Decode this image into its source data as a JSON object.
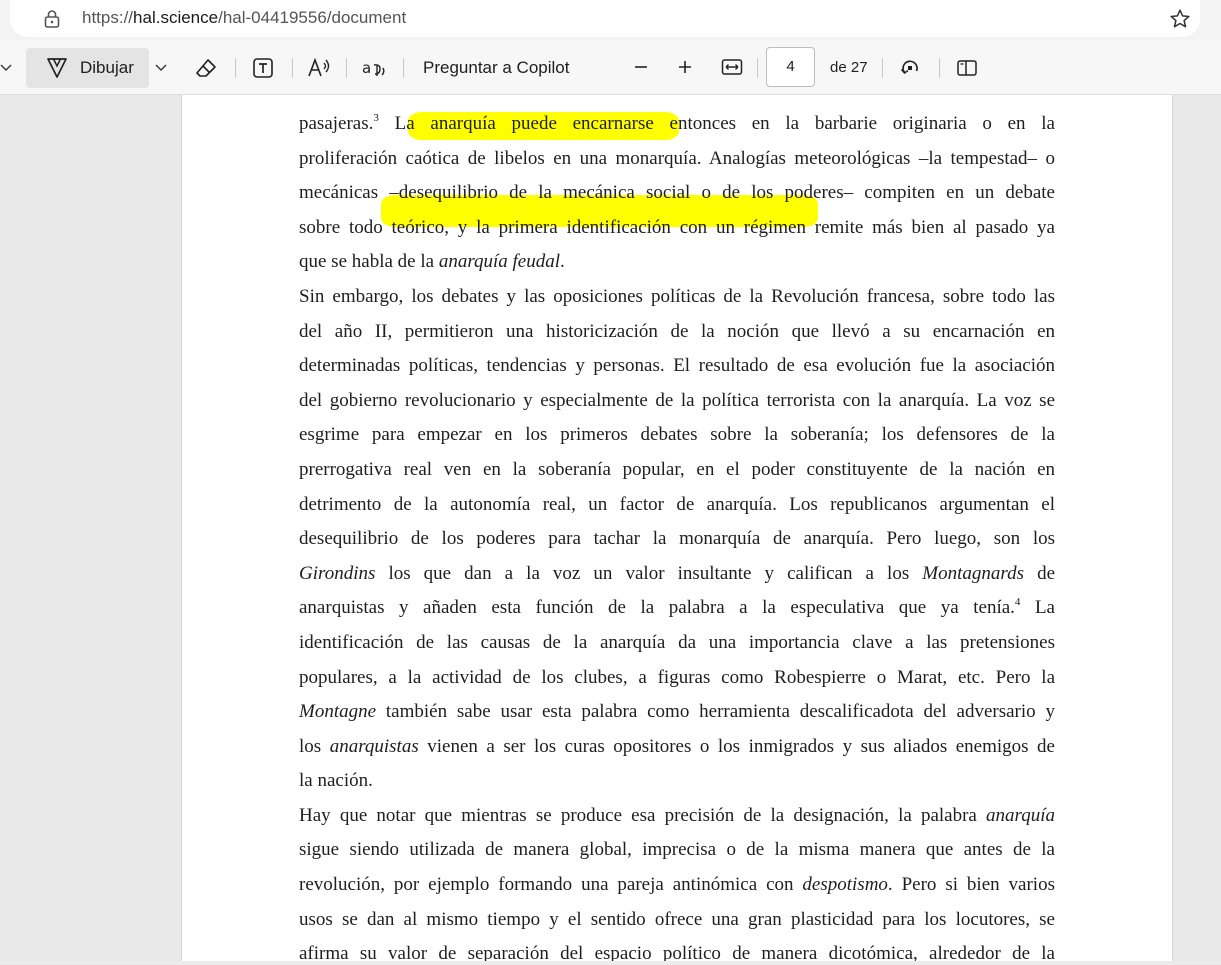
{
  "browser": {
    "url_scheme": "https://",
    "url_host": "hal.science",
    "url_path": "/hal-04419556/document"
  },
  "toolbar": {
    "draw_label": "Dibujar",
    "copilot_label": "Preguntar a Copilot",
    "current_page": "4",
    "page_total": "de 27"
  },
  "document": {
    "lines": [
      [
        {
          "t": "pasajeras."
        },
        {
          "t": "3",
          "sup": true
        },
        {
          "t": " La anarquía puede encarnarse entonces en la barbarie originaria o en la"
        }
      ],
      [
        {
          "t": "proliferación caótica de libelos en una monarquía. Analogías meteorológicas –la tempestad– o"
        }
      ],
      [
        {
          "t": "mecánicas –desequilibrio de la mecánica social o de los poderes– compiten en un debate"
        }
      ],
      [
        {
          "t": "sobre todo teórico, y la primera identificación con un régimen remite más bien al pasado ya"
        }
      ],
      [
        {
          "t": "que se habla de la "
        },
        {
          "t": "anarquía feudal",
          "i": true
        },
        {
          "t": "."
        }
      ],
      [
        {
          "t": "Sin embargo, los debates y las oposiciones políticas de la Revolución francesa, sobre todo las"
        }
      ],
      [
        {
          "t": "del año II, permitieron una historicización de la noción que llevó a su encarnación en"
        }
      ],
      [
        {
          "t": "determinadas políticas, tendencias y personas. El resultado de esa evolución fue la asociación"
        }
      ],
      [
        {
          "t": "del gobierno revolucionario y especialmente de la política terrorista con la anarquía. La voz se"
        }
      ],
      [
        {
          "t": "esgrime para empezar en los primeros debates sobre la soberanía; los defensores de la"
        }
      ],
      [
        {
          "t": "prerrogativa real ven en la soberanía popular, en el poder constituyente de la nación en"
        }
      ],
      [
        {
          "t": "detrimento de la autonomía real, un factor de anarquía. Los republicanos argumentan el"
        }
      ],
      [
        {
          "t": "desequilibrio de los poderes para tachar la monarquía de anarquía. Pero luego, son los"
        }
      ],
      [
        {
          "t": "Girondins",
          "i": true
        },
        {
          "t": " los que dan a la voz un valor insultante y califican a los "
        },
        {
          "t": "Montagnards",
          "i": true
        },
        {
          "t": " de"
        }
      ],
      [
        {
          "t": "anarquistas y añaden esta función de la palabra a la especulativa que ya tenía."
        },
        {
          "t": "4",
          "sup": true
        },
        {
          "t": " La"
        }
      ],
      [
        {
          "t": "identificación de las causas de la anarquía da una importancia clave a las pretensiones"
        }
      ],
      [
        {
          "t": "populares, a la actividad de los clubes, a figuras como Robespierre o Marat, etc. Pero la"
        }
      ],
      [
        {
          "t": "Montagne",
          "i": true
        },
        {
          "t": " también sabe usar esta palabra como herramienta descalificadota del adversario y"
        }
      ],
      [
        {
          "t": "los "
        },
        {
          "t": "anarquistas",
          "i": true
        },
        {
          "t": " vienen a ser los curas opositores o los inmigrados y sus aliados enemigos de"
        }
      ],
      [
        {
          "t": "la nación."
        }
      ],
      [
        {
          "t": "Hay que notar que mientras se produce esa precisión de la designación, la palabra "
        },
        {
          "t": "anarquía",
          "i": true
        }
      ],
      [
        {
          "t": "sigue siendo utilizada de manera global, imprecisa o de la misma manera que antes de la"
        }
      ],
      [
        {
          "t": "revolución, por ejemplo formando una pareja antinómica con "
        },
        {
          "t": "despotismo",
          "i": true
        },
        {
          "t": ". Pero si bien varios"
        }
      ],
      [
        {
          "t": "usos se dan al mismo tiempo y el sentido ofrece una gran plasticidad para los locutores, se"
        }
      ],
      [
        {
          "t": "afirma su valor de separación del espacio político de manera dicotómica, alrededor de la"
        }
      ]
    ],
    "last_line_indexes": [
      4,
      19
    ],
    "highlight_color": "#ffff00"
  }
}
